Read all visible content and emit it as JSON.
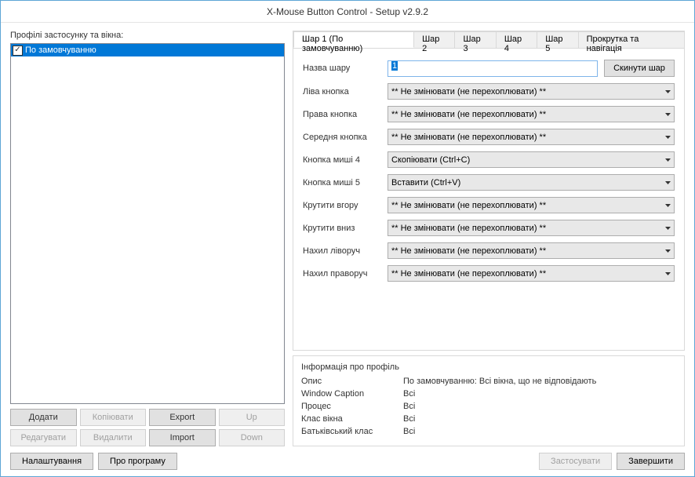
{
  "window": {
    "title": "X-Mouse Button Control - Setup v2.9.2"
  },
  "left": {
    "label": "Профілі застосунку та вікна:",
    "profiles": [
      {
        "checked": true,
        "name": "По замовчуванню",
        "selected": true
      }
    ],
    "buttons": {
      "add": "Додати",
      "copy": "Копіювати",
      "export": "Export",
      "up": "Up",
      "edit": "Редагувати",
      "delete": "Видалити",
      "import": "Import",
      "down": "Down"
    }
  },
  "tabs": {
    "items": [
      "Шар 1 (По замовчуванню)",
      "Шар 2",
      "Шар 3",
      "Шар 4",
      "Шар 5",
      "Прокрутка та навігація"
    ]
  },
  "layer": {
    "name_label": "Назва шару",
    "name_value": "1",
    "reset": "Скинути шар",
    "rows": [
      {
        "label": "Ліва кнопка",
        "value": "** Не змінювати (не перехоплювати) **"
      },
      {
        "label": "Права кнопка",
        "value": "** Не змінювати (не перехоплювати) **"
      },
      {
        "label": "Середня кнопка",
        "value": "** Не змінювати (не перехоплювати) **"
      },
      {
        "label": "Кнопка миші 4",
        "value": "Скопіювати (Ctrl+C)"
      },
      {
        "label": "Кнопка миші 5",
        "value": "Вставити (Ctrl+V)"
      },
      {
        "label": "Крутити вгору",
        "value": "** Не змінювати (не перехоплювати) **"
      },
      {
        "label": "Крутити вниз",
        "value": "** Не змінювати (не перехоплювати) **"
      },
      {
        "label": "Нахил ліворуч",
        "value": "** Не змінювати (не перехоплювати) **"
      },
      {
        "label": "Нахил праворуч",
        "value": "** Не змінювати (не перехоплювати) **"
      }
    ]
  },
  "profile_info": {
    "title": "Інформація про профіль",
    "rows": [
      {
        "label": "Опис",
        "value": "По замовчуванню: Всі вікна, що не відповідають"
      },
      {
        "label": "Window Caption",
        "value": "Всі"
      },
      {
        "label": "Процес",
        "value": "Всі"
      },
      {
        "label": "Клас вікна",
        "value": "Всі"
      },
      {
        "label": "Батьківський клас",
        "value": "Всі"
      }
    ]
  },
  "bottom": {
    "settings": "Налаштування",
    "about": "Про програму",
    "apply": "Застосувати",
    "close": "Завершити"
  }
}
